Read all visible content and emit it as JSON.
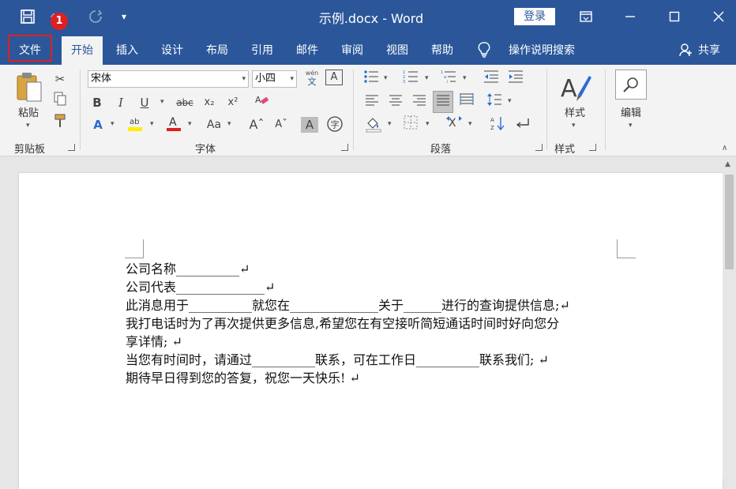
{
  "titlebar": {
    "title": "示例.docx - Word",
    "login": "登录",
    "badge": "1",
    "icons": {
      "save": "save-icon",
      "undo": "undo-icon",
      "redo": "redo-icon",
      "customize": "customize-icon"
    }
  },
  "tabs": [
    "文件",
    "开始",
    "插入",
    "设计",
    "布局",
    "引用",
    "邮件",
    "审阅",
    "视图",
    "帮助"
  ],
  "active_tab": "开始",
  "search_label": "操作说明搜索",
  "share_label": "共享",
  "clipboard": {
    "paste": "粘贴",
    "label": "剪贴板"
  },
  "font": {
    "name": "宋体",
    "size": "小四",
    "phonetic": "wén",
    "phonetic_char": "文",
    "label": "字体"
  },
  "paragraph": {
    "label": "段落"
  },
  "styles": {
    "button": "样式",
    "label": "样式"
  },
  "editing": {
    "button": "编辑"
  },
  "document": {
    "lines": [
      "公司名称__________↵",
      "公司代表______________↵",
      "此消息用于__________就您在______________关于______进行的查询提供信息;↵",
      "我打电话时为了再次提供更多信息,希望您在有空接听简短通话时间时好向您分",
      "享详情; ↵",
      "当您有时间时，请通过__________联系，可在工作日__________联系我们; ↵",
      "期待早日得到您的答复，祝您一天快乐! ↵"
    ]
  },
  "colors": {
    "brand": "#2b579a",
    "highlight": "#e02020"
  }
}
